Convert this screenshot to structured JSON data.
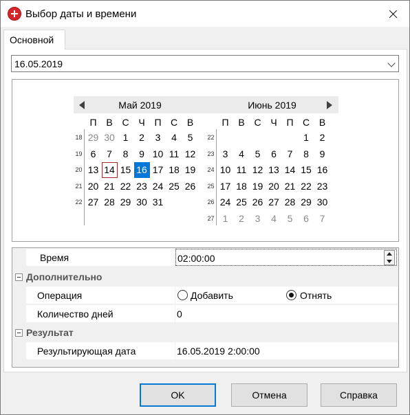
{
  "window": {
    "title": "Выбор даты и времени",
    "tab": "Основной"
  },
  "date_value": "16.05.2019",
  "calendar": {
    "weekdays": [
      "П",
      "В",
      "С",
      "Ч",
      "П",
      "С",
      "В"
    ],
    "months": [
      {
        "title": "Май 2019",
        "weeks": [
          {
            "num": "18",
            "days": [
              "29",
              "30",
              "1",
              "2",
              "3",
              "4",
              "5"
            ],
            "other": [
              true,
              true,
              false,
              false,
              false,
              false,
              false
            ]
          },
          {
            "num": "19",
            "days": [
              "6",
              "7",
              "8",
              "9",
              "10",
              "11",
              "12"
            ],
            "other": [
              false,
              false,
              false,
              false,
              false,
              false,
              false
            ]
          },
          {
            "num": "20",
            "days": [
              "13",
              "14",
              "15",
              "16",
              "17",
              "18",
              "19"
            ],
            "other": [
              false,
              false,
              false,
              false,
              false,
              false,
              false
            ]
          },
          {
            "num": "21",
            "days": [
              "20",
              "21",
              "22",
              "23",
              "24",
              "25",
              "26"
            ],
            "other": [
              false,
              false,
              false,
              false,
              false,
              false,
              false
            ]
          },
          {
            "num": "22",
            "days": [
              "27",
              "28",
              "29",
              "30",
              "31",
              "",
              ""
            ],
            "other": [
              false,
              false,
              false,
              false,
              false,
              false,
              false
            ]
          }
        ],
        "today": "14",
        "selected": "16"
      },
      {
        "title": "Июнь 2019",
        "weeks": [
          {
            "num": "22",
            "days": [
              "",
              "",
              "",
              "",
              "",
              "1",
              "2"
            ],
            "other": [
              false,
              false,
              false,
              false,
              false,
              false,
              false
            ]
          },
          {
            "num": "23",
            "days": [
              "3",
              "4",
              "5",
              "6",
              "7",
              "8",
              "9"
            ],
            "other": [
              false,
              false,
              false,
              false,
              false,
              false,
              false
            ]
          },
          {
            "num": "24",
            "days": [
              "10",
              "11",
              "12",
              "13",
              "14",
              "15",
              "16"
            ],
            "other": [
              false,
              false,
              false,
              false,
              false,
              false,
              false
            ]
          },
          {
            "num": "25",
            "days": [
              "17",
              "18",
              "19",
              "20",
              "21",
              "22",
              "23"
            ],
            "other": [
              false,
              false,
              false,
              false,
              false,
              false,
              false
            ]
          },
          {
            "num": "26",
            "days": [
              "24",
              "25",
              "26",
              "27",
              "28",
              "29",
              "30"
            ],
            "other": [
              false,
              false,
              false,
              false,
              false,
              false,
              false
            ]
          },
          {
            "num": "27",
            "days": [
              "1",
              "2",
              "3",
              "4",
              "5",
              "6",
              "7"
            ],
            "other": [
              true,
              true,
              true,
              true,
              true,
              true,
              true
            ]
          }
        ],
        "today": "",
        "selected": ""
      }
    ]
  },
  "properties": {
    "time_label": "Время",
    "time_value": "02:00:00",
    "cat_additional": "Дополнительно",
    "operation_label": "Операция",
    "op_add": "Добавить",
    "op_subtract": "Отнять",
    "op_selected": "subtract",
    "days_label": "Количество дней",
    "days_value": "0",
    "cat_result": "Результат",
    "result_label": "Результирующая дата",
    "result_value": "16.05.2019 2:00:00"
  },
  "buttons": {
    "ok": "OK",
    "cancel": "Отмена",
    "help": "Справка"
  },
  "colors": {
    "selection": "#0078d7",
    "today_border": "#a52a2a",
    "muted_day": "#8a8a8a"
  }
}
